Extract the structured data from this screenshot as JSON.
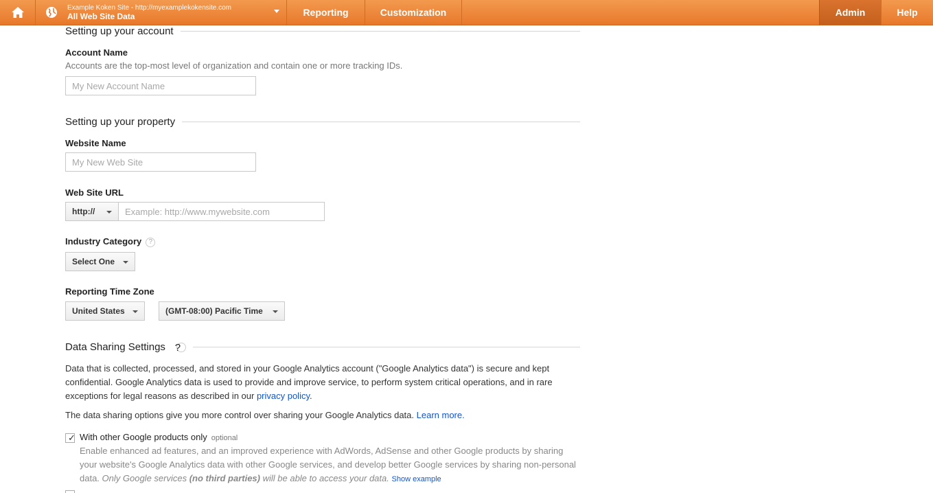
{
  "topbar": {
    "site_subtitle": "Example Koken Site - http://myexamplekokensite.com",
    "site_title": "All Web Site Data",
    "nav": {
      "reporting": "Reporting",
      "customization": "Customization",
      "admin": "Admin",
      "help": "Help"
    },
    "colors": {
      "bar": "#e8782a",
      "active": "#c4601c"
    }
  },
  "account": {
    "section_title": "Setting up your account",
    "name_label": "Account Name",
    "name_help": "Accounts are the top-most level of organization and contain one or more tracking IDs.",
    "name_placeholder": "My New Account Name"
  },
  "property": {
    "section_title": "Setting up your property",
    "website_name_label": "Website Name",
    "website_name_placeholder": "My New Web Site",
    "url_label": "Web Site URL",
    "protocol_value": "http://",
    "url_placeholder": "Example: http://www.mywebsite.com",
    "industry_label": "Industry Category",
    "industry_value": "Select One",
    "timezone_label": "Reporting Time Zone",
    "country_value": "United States",
    "timezone_value": "(GMT-08:00) Pacific Time"
  },
  "data_sharing": {
    "section_title": "Data Sharing Settings",
    "para1_a": "Data that is collected, processed, and stored in your Google Analytics account (\"Google Analytics data\") is secure and kept confidential. Google Analytics data is used to provide and improve service, to perform system critical operations, and in rare exceptions for legal reasons as described in our ",
    "para1_link": "privacy policy",
    "para1_end": ".",
    "para2_a": "The data sharing options give you more control over sharing your Google Analytics data. ",
    "para2_link": "Learn more.",
    "option1": {
      "label": "With other Google products only",
      "optional": "optional",
      "checked": true,
      "desc_a": "Enable enhanced ad features, and an improved experience with AdWords, AdSense and other Google products by sharing your website's Google Analytics data with other Google services, and develop better Google services by sharing non-personal data. ",
      "desc_italic_a": "Only Google services ",
      "desc_bold_italic": "(no third parties)",
      "desc_italic_b": " will be able to access your data.",
      "show_example": "Show example"
    }
  }
}
